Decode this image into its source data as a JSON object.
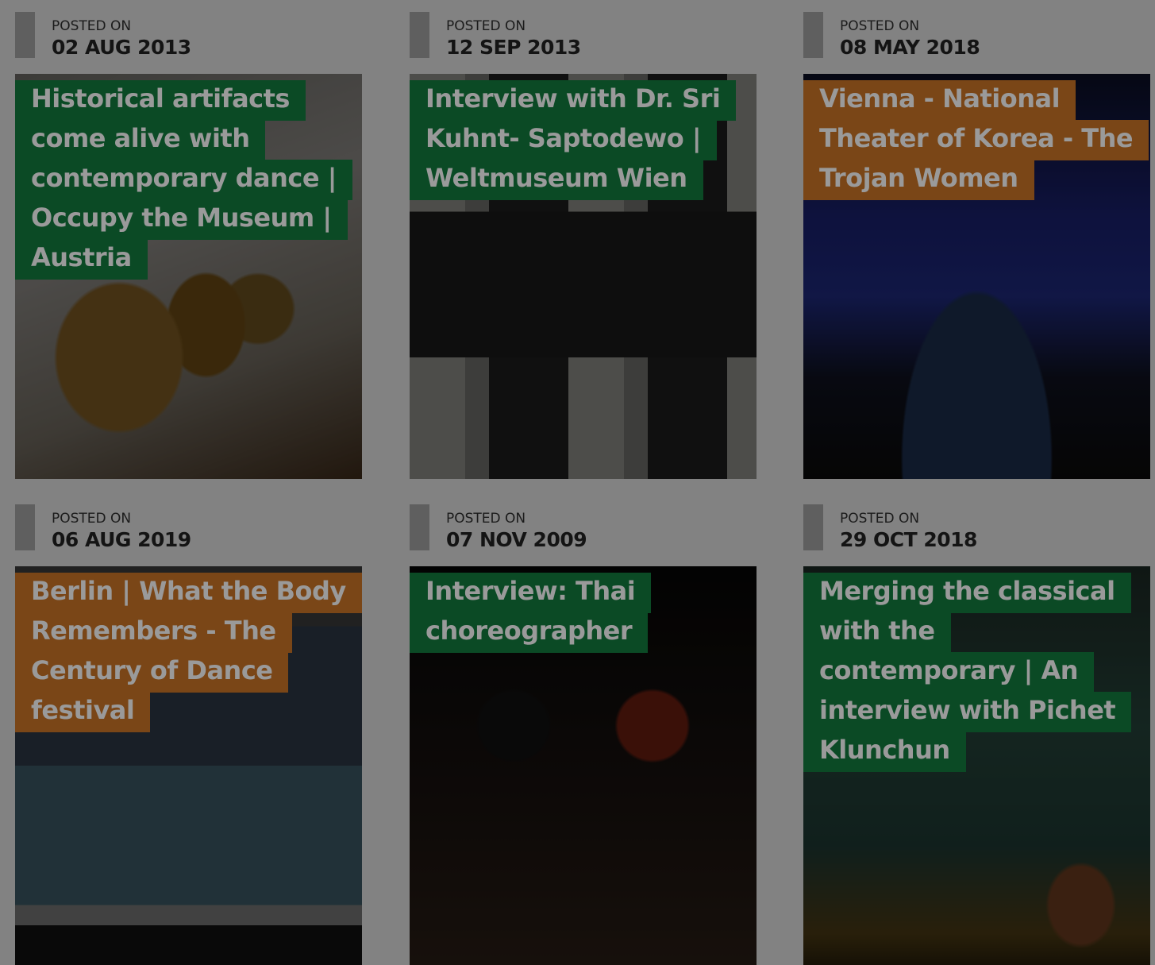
{
  "posts": [
    {
      "posted_label": "POSTED ON",
      "date": "02 AUG 2013",
      "title": "Historical artifacts come alive with contemporary dance | Occupy the Museum | Austria",
      "title_color": "#0b4a25"
    },
    {
      "posted_label": "POSTED ON",
      "date": "12 SEP 2013",
      "title": "Interview with Dr. Sri Kuhnt- Saptodewo | Weltmuseum Wien",
      "title_color": "#0b4a25"
    },
    {
      "posted_label": "POSTED ON",
      "date": "08 MAY 2018",
      "title": "Vienna - National Theater of Korea - The Trojan Women",
      "title_color": "#7a4617"
    },
    {
      "posted_label": "POSTED ON",
      "date": "06 AUG 2019",
      "title": "Berlin | What the Body Remembers - The Century of Dance festival",
      "title_color": "#7a4617"
    },
    {
      "posted_label": "POSTED ON",
      "date": "07 NOV 2009",
      "title": "Interview: Thai choreographer",
      "title_color": "#0b4a25"
    },
    {
      "posted_label": "POSTED ON",
      "date": "29 OCT 2018",
      "title": "Merging the classical with the contemporary | An interview with Pichet Klunchun",
      "title_color": "#0b4a25"
    }
  ]
}
